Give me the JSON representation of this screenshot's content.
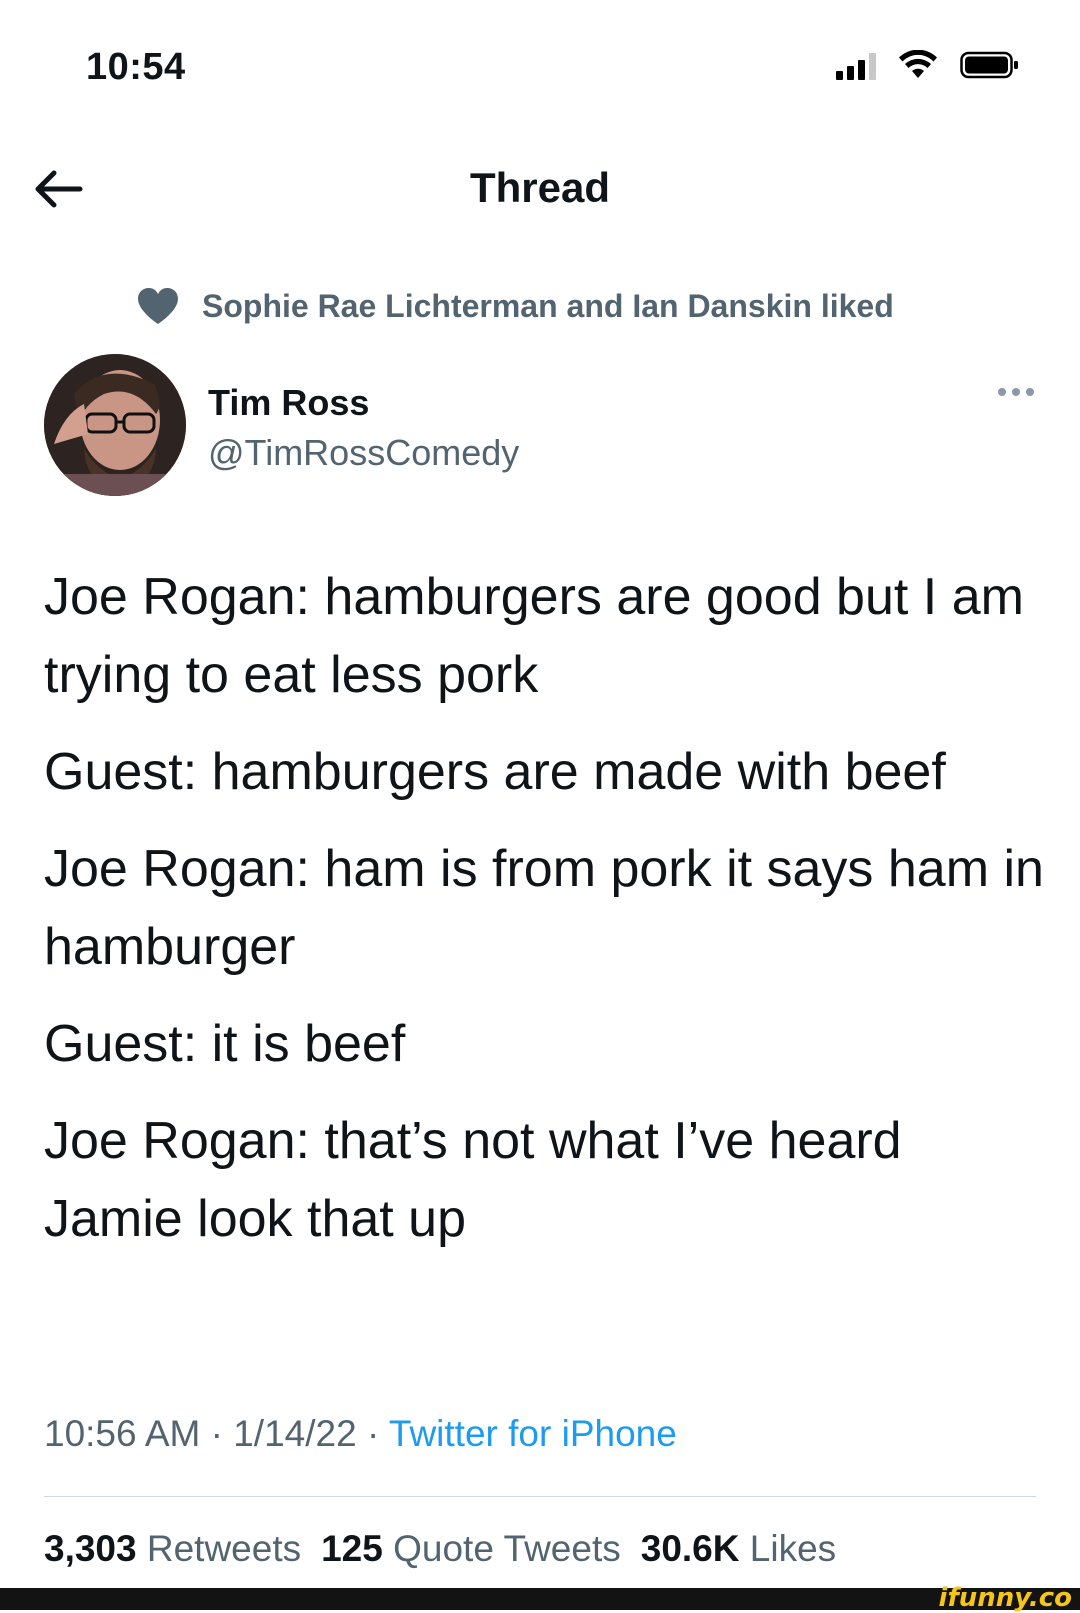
{
  "status_bar": {
    "time": "10:54"
  },
  "nav": {
    "title": "Thread"
  },
  "social_context": {
    "text": "Sophie Rae Lichterman and Ian Danskin liked"
  },
  "author": {
    "name": "Tim Ross",
    "handle": "@TimRossComedy"
  },
  "tweet": {
    "paragraphs": [
      "Joe Rogan: hamburgers are good but I am trying to eat less pork",
      "Guest: hamburgers are made with beef",
      "Joe Rogan: ham is from pork it says ham in hamburger",
      "Guest: it is beef",
      "Joe Rogan: that’s not what I’ve heard Jamie look that up"
    ],
    "time": "10:56 AM",
    "date": "1/14/22",
    "source": "Twitter for iPhone",
    "separator": " · "
  },
  "engagement": {
    "retweets_count": "3,303",
    "retweets_label": "Retweets",
    "quotes_count": "125",
    "quotes_label": "Quote Tweets",
    "likes_count": "30.6K",
    "likes_label": "Likes"
  },
  "watermark": {
    "text": "ifunny.co"
  },
  "colors": {
    "text_primary": "#0f1419",
    "text_secondary": "#536471",
    "link": "#1d9bf0",
    "divider": "#cfd9de"
  }
}
